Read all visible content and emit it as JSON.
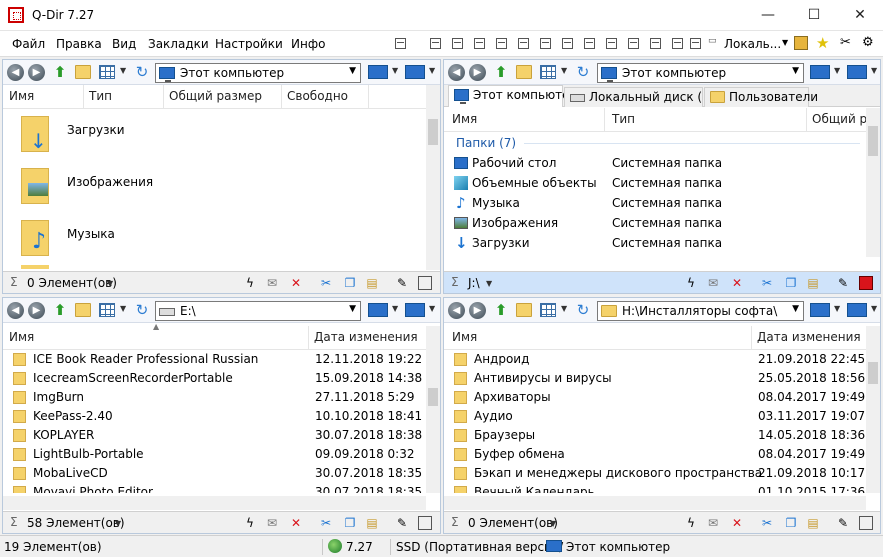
{
  "window": {
    "title": "Q-Dir 7.27",
    "minimize": "—",
    "maximize": "☐",
    "close": "✕"
  },
  "menu": [
    "Файл",
    "Правка",
    "Вид",
    "Закладки",
    "Настройки",
    "Инфо"
  ],
  "toolbar": {
    "drive_label": "Локаль..."
  },
  "panes": {
    "top_left": {
      "address": "Этот компьютер",
      "columns": [
        "Имя",
        "Тип",
        "Общий размер",
        "Свободно"
      ],
      "items": [
        {
          "name": "Загрузки",
          "icon": "downloads-folder-icon"
        },
        {
          "name": "Изображения",
          "icon": "pictures-folder-icon"
        },
        {
          "name": "Музыка",
          "icon": "music-folder-icon"
        }
      ],
      "status": "0 Элемент(ов)"
    },
    "top_right": {
      "address": "Этот компьютер",
      "tabs": [
        "Этот компьютер",
        "Локальный диск ( ...",
        "Пользователи"
      ],
      "columns": [
        "Имя",
        "Тип",
        "Общий р"
      ],
      "group": "Папки (7)",
      "items": [
        {
          "name": "Рабочий стол",
          "type": "Системная папка",
          "icon": "desktop-icon"
        },
        {
          "name": "Объемные объекты",
          "type": "Системная папка",
          "icon": "3d-objects-icon"
        },
        {
          "name": "Музыка",
          "type": "Системная папка",
          "icon": "music-icon"
        },
        {
          "name": "Изображения",
          "type": "Системная папка",
          "icon": "pictures-icon"
        },
        {
          "name": "Загрузки",
          "type": "Системная папка",
          "icon": "downloads-icon"
        }
      ],
      "status": "J:\\"
    },
    "bottom_left": {
      "address": "E:\\",
      "columns": [
        "Имя",
        "Дата изменения"
      ],
      "items": [
        {
          "name": "ICE Book Reader Professional Russian",
          "date": "12.11.2018 19:22"
        },
        {
          "name": "IcecreamScreenRecorderPortable",
          "date": "15.09.2018 14:38"
        },
        {
          "name": "ImgBurn",
          "date": "27.11.2018 5:29"
        },
        {
          "name": "KeePass-2.40",
          "date": "10.10.2018 18:41"
        },
        {
          "name": "KOPLAYER",
          "date": "30.07.2018 18:38"
        },
        {
          "name": "LightBulb-Portable",
          "date": "09.09.2018 0:32"
        },
        {
          "name": "MobaLiveCD",
          "date": "30.07.2018 18:35"
        },
        {
          "name": "Movavi Photo Editor",
          "date": "30.07.2018 18:35"
        }
      ],
      "status": "58 Элемент(ов)"
    },
    "bottom_right": {
      "address": "H:\\Инсталляторы софта\\",
      "columns": [
        "Имя",
        "Дата изменения"
      ],
      "items": [
        {
          "name": "Андроид",
          "date": "21.09.2018 22:45"
        },
        {
          "name": "Антивирусы и вирусы",
          "date": "25.05.2018 18:56"
        },
        {
          "name": "Архиваторы",
          "date": "08.04.2017 19:49"
        },
        {
          "name": "Аудио",
          "date": "03.11.2017 19:07"
        },
        {
          "name": "Браузеры",
          "date": "14.05.2018 18:36"
        },
        {
          "name": "Буфер обмена",
          "date": "08.04.2017 19:49"
        },
        {
          "name": "Бэкап и менеджеры дискового пространства",
          "date": "21.09.2018 10:17"
        },
        {
          "name": "Вечный Календарь",
          "date": "01.10.2015 17:36"
        }
      ],
      "status": "0 Элемент(ов)"
    }
  },
  "statusbar": {
    "items": "19 Элемент(ов)",
    "version": "7.27",
    "edition": "SSD (Портативная версия/",
    "location": "Этот компьютер"
  },
  "colors": {
    "accent": "#2a6fc9",
    "folder": "#f5d26a",
    "active_status": "#cfe3fa",
    "delete": "#d9141b"
  }
}
